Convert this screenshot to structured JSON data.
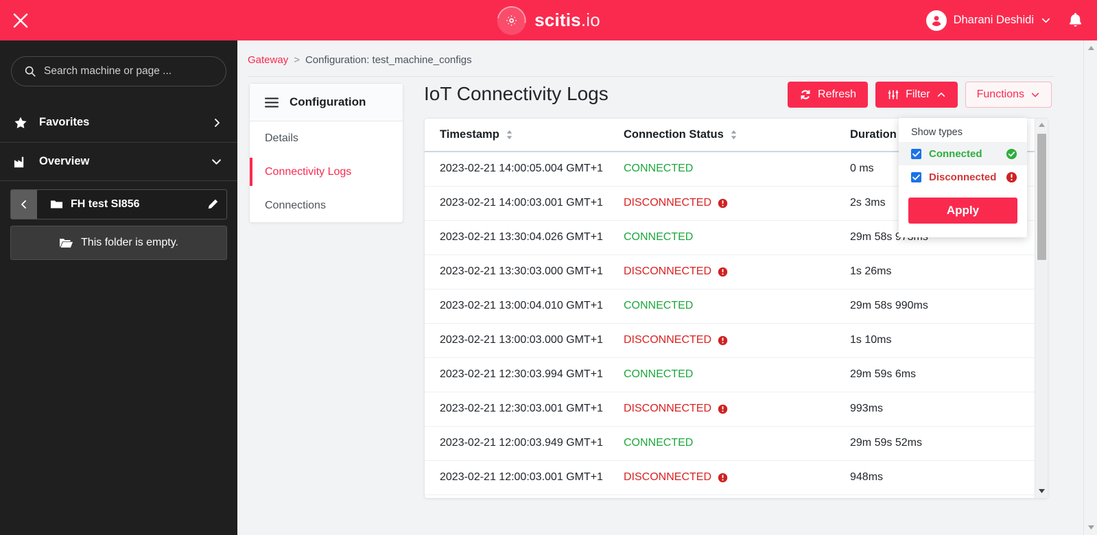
{
  "topbar": {
    "close_icon": "close-icon",
    "brand_name": "scitis",
    "brand_suffix": ".io",
    "user_name": "Dharani Deshidi",
    "bell_icon": "bell-icon",
    "accent_color": "#fa2a4f"
  },
  "sidebar": {
    "search_placeholder": "Search machine or page ...",
    "search_value": "",
    "favorites_label": "Favorites",
    "overview_label": "Overview",
    "folder_name": "FH test SI856",
    "empty_label": "This folder is empty."
  },
  "breadcrumb": {
    "root": "Gateway",
    "separator": ">",
    "current": "Configuration: test_machine_configs"
  },
  "config_panel": {
    "title": "Configuration",
    "items": [
      {
        "label": "Details",
        "active": false
      },
      {
        "label": "Connectivity Logs",
        "active": true
      },
      {
        "label": "Connections",
        "active": false
      }
    ]
  },
  "page": {
    "title": "IoT Connectivity Logs",
    "buttons": {
      "refresh": "Refresh",
      "filter": "Filter",
      "functions": "Functions"
    }
  },
  "table": {
    "columns": [
      "Timestamp",
      "Connection Status",
      "Duration"
    ],
    "rows": [
      {
        "timestamp": "2023-02-21 14:00:05.004 GMT+1",
        "status": "CONNECTED",
        "duration": "0 ms"
      },
      {
        "timestamp": "2023-02-21 14:00:03.001 GMT+1",
        "status": "DISCONNECTED",
        "duration": "2s 3ms"
      },
      {
        "timestamp": "2023-02-21 13:30:04.026 GMT+1",
        "status": "CONNECTED",
        "duration": "29m 58s 973ms"
      },
      {
        "timestamp": "2023-02-21 13:30:03.000 GMT+1",
        "status": "DISCONNECTED",
        "duration": "1s 26ms"
      },
      {
        "timestamp": "2023-02-21 13:00:04.010 GMT+1",
        "status": "CONNECTED",
        "duration": "29m 58s 990ms"
      },
      {
        "timestamp": "2023-02-21 13:00:03.000 GMT+1",
        "status": "DISCONNECTED",
        "duration": "1s 10ms"
      },
      {
        "timestamp": "2023-02-21 12:30:03.994 GMT+1",
        "status": "CONNECTED",
        "duration": "29m 59s 6ms"
      },
      {
        "timestamp": "2023-02-21 12:30:03.001 GMT+1",
        "status": "DISCONNECTED",
        "duration": "993ms"
      },
      {
        "timestamp": "2023-02-21 12:00:03.949 GMT+1",
        "status": "CONNECTED",
        "duration": "29m 59s 52ms"
      },
      {
        "timestamp": "2023-02-21 12:00:03.001 GMT+1",
        "status": "DISCONNECTED",
        "duration": "948ms"
      }
    ]
  },
  "filter_popup": {
    "title": "Show types",
    "options": [
      {
        "label": "Connected",
        "checked": true,
        "color": "#2eae3e"
      },
      {
        "label": "Disconnected",
        "checked": true,
        "color": "#d13636"
      }
    ],
    "apply_label": "Apply"
  }
}
